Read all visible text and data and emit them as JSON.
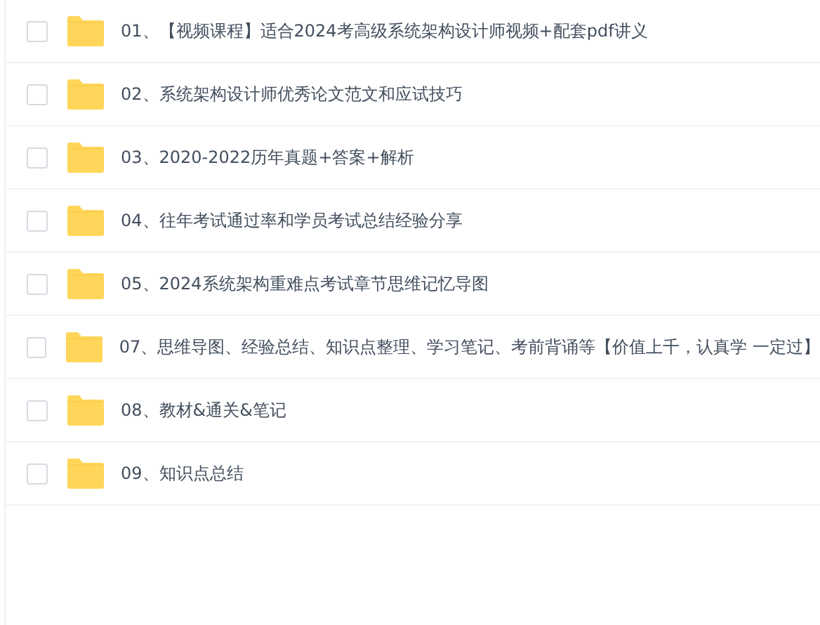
{
  "files": [
    {
      "name": "01、【视频课程】适合2024考高级系统架构设计师视频+配套pdf讲义",
      "checked": false
    },
    {
      "name": "02、系统架构设计师优秀论文范文和应试技巧",
      "checked": false
    },
    {
      "name": "03、2020-2022历年真题+答案+解析",
      "checked": false
    },
    {
      "name": "04、往年考试通过率和学员考试总结经验分享",
      "checked": false
    },
    {
      "name": "05、2024系统架构重难点考试章节思维记忆导图",
      "checked": false
    },
    {
      "name": "07、思维导图、经验总结、知识点整理、学习笔记、考前背诵等【价值上千，认真学 一定过】",
      "checked": false
    },
    {
      "name": "08、教材&通关&笔记",
      "checked": false
    },
    {
      "name": "09、知识点总结",
      "checked": false
    }
  ]
}
